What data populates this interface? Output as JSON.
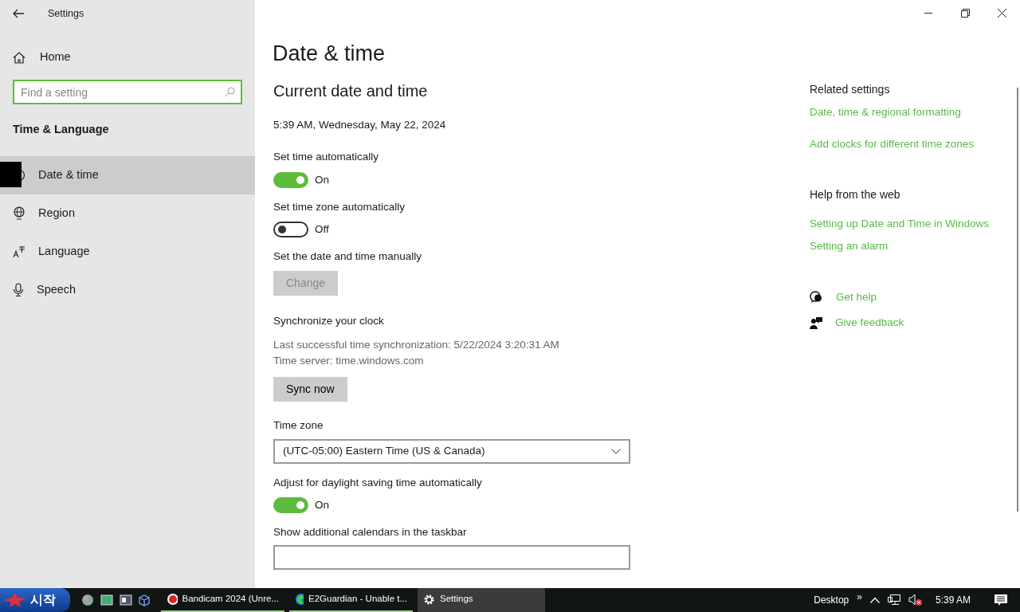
{
  "window": {
    "title": "Settings"
  },
  "sidebar": {
    "home": "Home",
    "search": {
      "placeholder": "Find a setting"
    },
    "section": "Time & Language",
    "items": [
      {
        "label": "Date & time",
        "selected": true
      },
      {
        "label": "Region",
        "selected": false
      },
      {
        "label": "Language",
        "selected": false
      },
      {
        "label": "Speech",
        "selected": false
      }
    ]
  },
  "page": {
    "title": "Date & time",
    "section": "Current date and time",
    "current": "5:39 AM, Wednesday, May 22, 2024",
    "controls": [
      {
        "kind": "toggle",
        "label": "Set time automatically",
        "on": true,
        "state_text": "On"
      },
      {
        "kind": "toggle",
        "label": "Set time zone automatically",
        "on": false,
        "state_text": "Off"
      },
      {
        "kind": "button",
        "label": "Set the date and time manually",
        "button": "Change",
        "disabled": true
      },
      {
        "kind": "sync",
        "label": "Synchronize your clock",
        "details": [
          "Last successful time synchronization: 5/22/2024 3:20:31 AM",
          "Time server: time.windows.com"
        ],
        "button": "Sync now"
      },
      {
        "kind": "dropdown",
        "label": "Time zone",
        "value": "(UTC-05:00) Eastern Time (US & Canada)"
      },
      {
        "kind": "toggle",
        "label": "Adjust for daylight saving time automatically",
        "on": true,
        "state_text": "On"
      },
      {
        "kind": "dropdown",
        "label": "Show additional calendars in the taskbar"
      }
    ]
  },
  "related": {
    "title": "Related settings",
    "links": [
      "Date, time & regional formatting",
      "Add clocks for different time zones"
    ]
  },
  "web_help": {
    "title": "Help from the web",
    "links": [
      "Setting up Date and Time in Windows",
      "Setting an alarm"
    ]
  },
  "support": [
    {
      "kind": "help",
      "label": "Get help"
    },
    {
      "kind": "feedback",
      "label": "Give feedback"
    }
  ],
  "taskbar": {
    "start": "시작",
    "tasks": [
      {
        "kind": "record",
        "label": "Bandicam 2024 (Unre...",
        "selected": false
      },
      {
        "kind": "browser",
        "label": "E2Guardian - Unable t...",
        "selected": false
      },
      {
        "kind": "gear",
        "label": "Settings",
        "selected": true
      }
    ],
    "desktop": "Desktop",
    "more": "»",
    "clock": "5:39 AM"
  }
}
